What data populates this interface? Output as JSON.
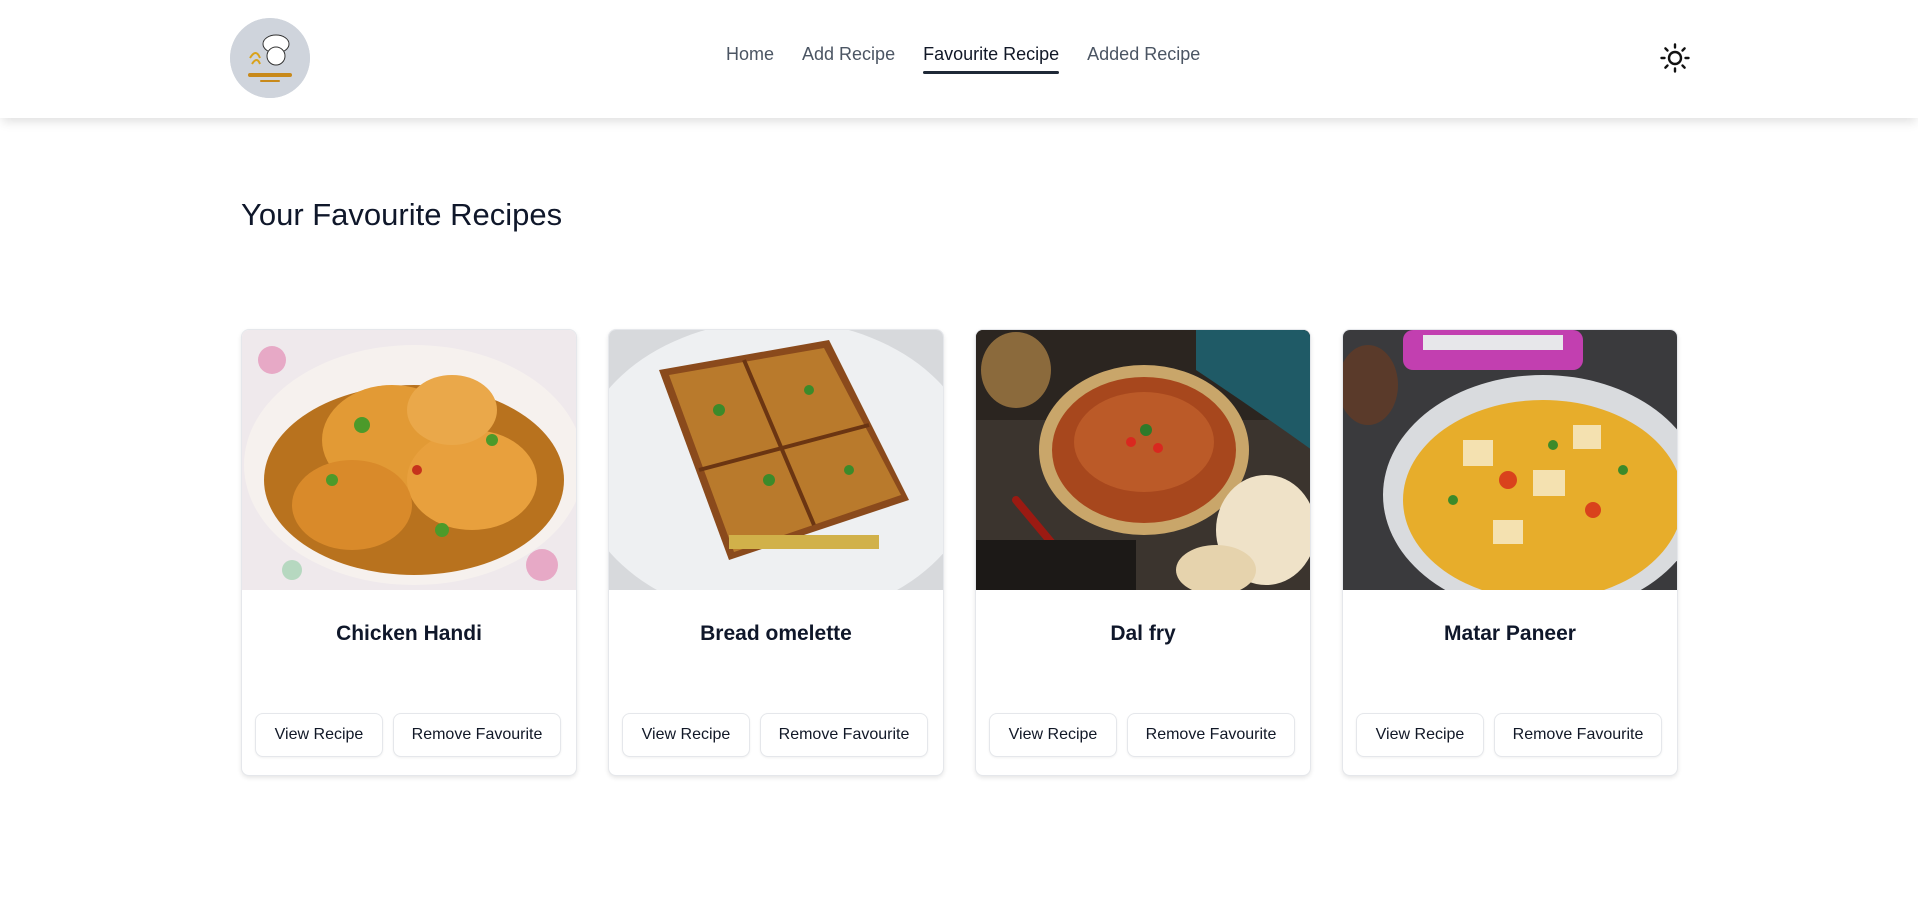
{
  "nav": {
    "items": [
      {
        "label": "Home",
        "active": false
      },
      {
        "label": "Add Recipe",
        "active": false
      },
      {
        "label": "Favourite Recipe",
        "active": true
      },
      {
        "label": "Added Recipe",
        "active": false
      }
    ],
    "theme_icon": "sun-icon"
  },
  "page": {
    "title": "Your Favourite Recipes"
  },
  "recipes": [
    {
      "name": "Chicken Handi",
      "view_label": "View Recipe",
      "remove_label": "Remove Favourite"
    },
    {
      "name": "Bread omelette",
      "view_label": "View Recipe",
      "remove_label": "Remove Favourite"
    },
    {
      "name": "Dal fry",
      "view_label": "View Recipe",
      "remove_label": "Remove Favourite"
    },
    {
      "name": "Matar Paneer",
      "view_label": "View Recipe",
      "remove_label": "Remove Favourite"
    }
  ],
  "colors": {
    "accent_underline": "#1f2937",
    "text": "#0f172a"
  }
}
